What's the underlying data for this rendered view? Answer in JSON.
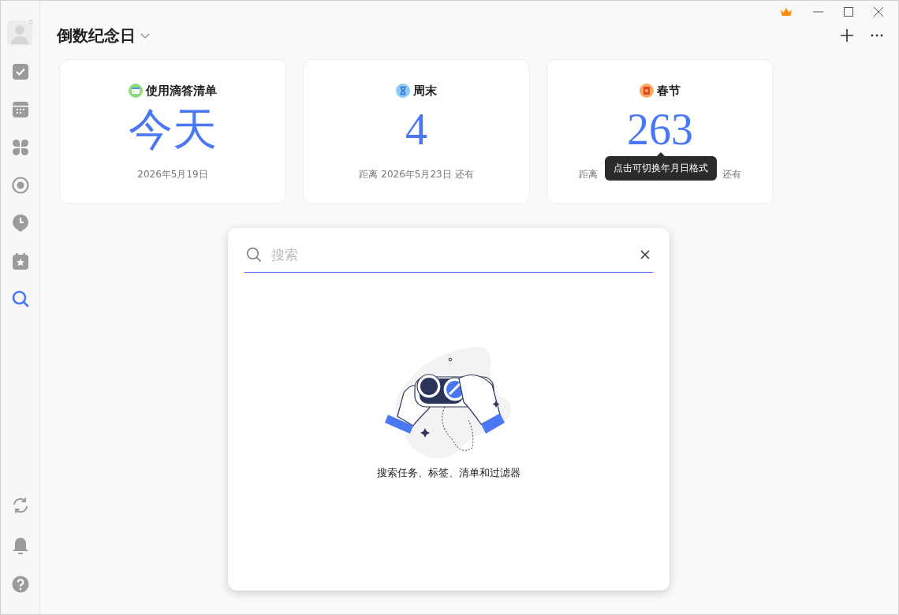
{
  "window": {
    "title": "倒数纪念日"
  },
  "sidebar": {
    "items": [
      {
        "kind": "tasks",
        "selected": false
      },
      {
        "kind": "calendar",
        "selected": false
      },
      {
        "kind": "matrix",
        "selected": false
      },
      {
        "kind": "focus",
        "selected": false
      },
      {
        "kind": "habit",
        "selected": false
      },
      {
        "kind": "countdown",
        "selected": false
      },
      {
        "kind": "search",
        "selected": true
      }
    ],
    "bottom_items": [
      {
        "kind": "sync"
      },
      {
        "kind": "bell"
      },
      {
        "kind": "help"
      }
    ]
  },
  "cards": [
    {
      "title": "使用滴答清单",
      "value": "今天",
      "subtitle": [
        "2026年5月19日"
      ]
    },
    {
      "title": "周末",
      "value": "4",
      "subtitle": [
        "距离 2026年5月23日 还有"
      ]
    },
    {
      "title": "春节",
      "value": "263",
      "subtitle": [
        "距离",
        "还有"
      ],
      "tooltip": "点击可切换年月日格式"
    }
  ],
  "search": {
    "placeholder": "搜索",
    "focused": true,
    "hint": "搜索任务、标签、清单和过滤器"
  }
}
